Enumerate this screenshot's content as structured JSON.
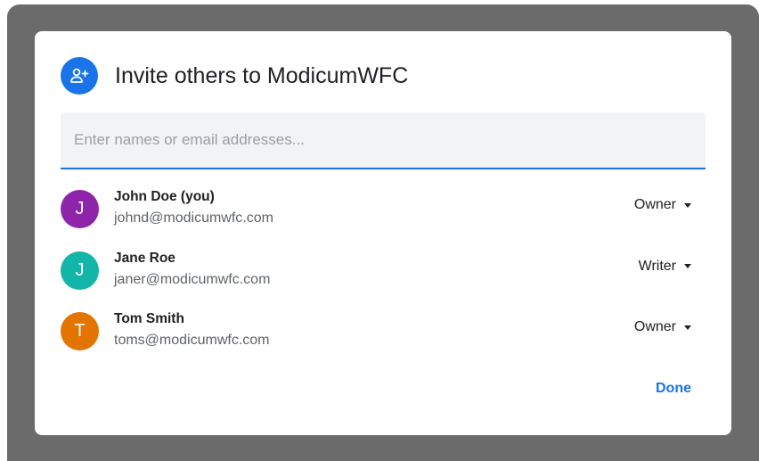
{
  "dialog": {
    "title": "Invite others to ModicumWFC",
    "header_icon": "person-add-icon",
    "accent_color": "#1a73e8"
  },
  "search": {
    "value": "",
    "placeholder": "Enter names or email addresses..."
  },
  "members": [
    {
      "initial": "J",
      "name": "John Doe (you)",
      "email": "johnd@modicumwfc.com",
      "role": "Owner",
      "avatar_color": "#8e24aa"
    },
    {
      "initial": "J",
      "name": "Jane Roe",
      "email": "janer@modicumwfc.com",
      "role": "Writer",
      "avatar_color": "#12b5a8"
    },
    {
      "initial": "T",
      "name": "Tom Smith",
      "email": "toms@modicumwfc.com",
      "role": "Owner",
      "avatar_color": "#e37400"
    }
  ],
  "actions": {
    "done_label": "Done"
  }
}
